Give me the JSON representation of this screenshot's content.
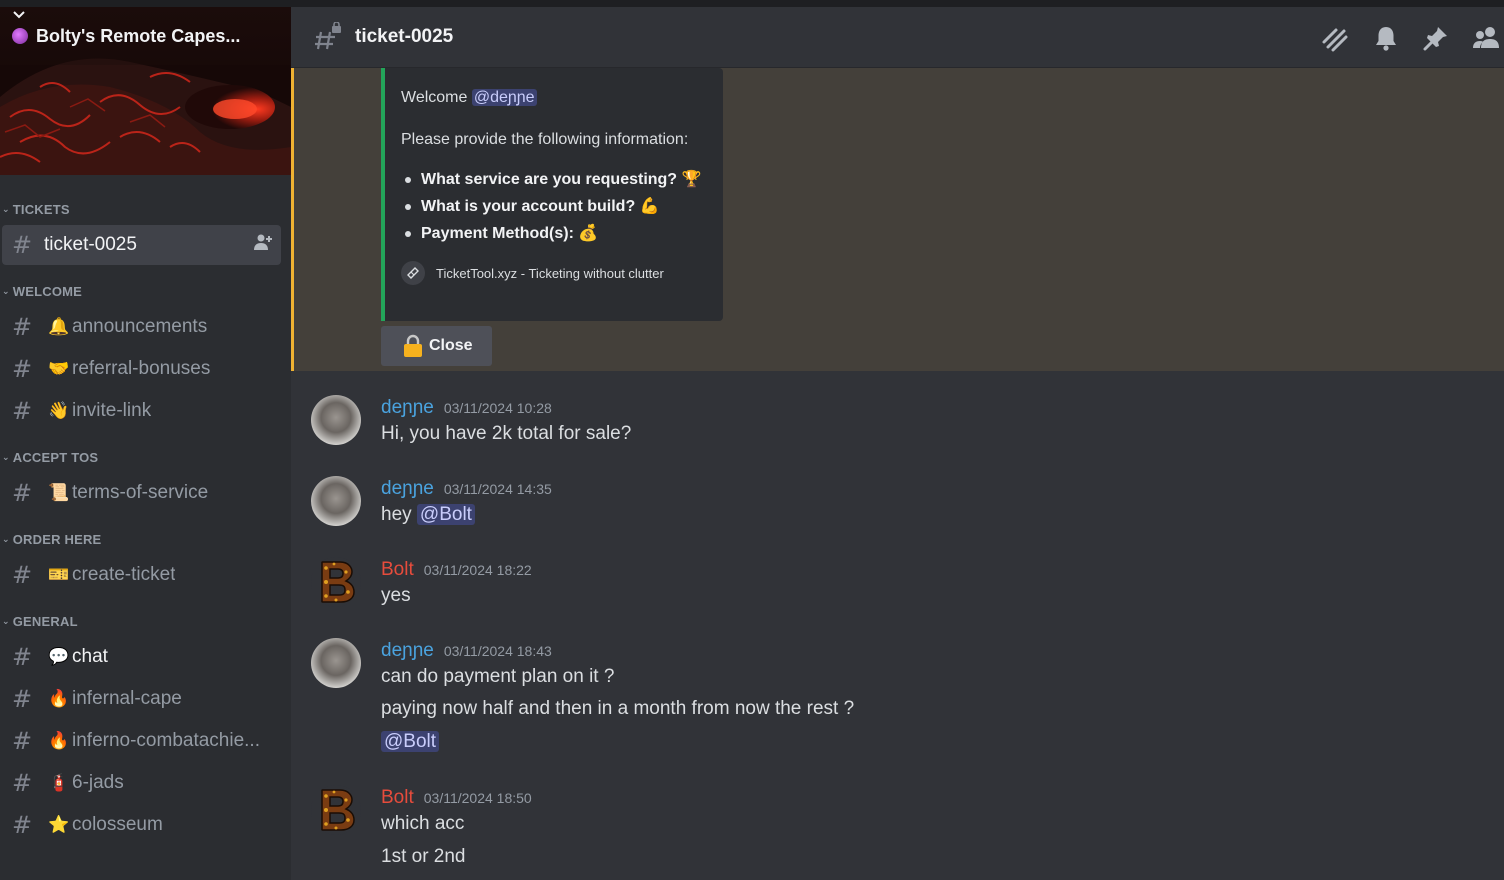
{
  "server": {
    "name": "Bolty's Remote Capes...",
    "icon": "server-icon"
  },
  "channel": {
    "title": "ticket-0025"
  },
  "toolbar_icons": [
    "threads-icon",
    "bell-icon",
    "pin-icon",
    "members-icon"
  ],
  "categories": [
    {
      "label": "TICKETS",
      "channels": [
        {
          "name": "ticket-0025",
          "emoji": "",
          "active": true
        }
      ]
    },
    {
      "label": "WELCOME",
      "channels": [
        {
          "name": "announcements",
          "emoji": "🔔"
        },
        {
          "name": "referral-bonuses",
          "emoji": "🤝"
        },
        {
          "name": "invite-link",
          "emoji": "👋"
        }
      ]
    },
    {
      "label": "ACCEPT TOS",
      "channels": [
        {
          "name": "terms-of-service",
          "emoji": "📜"
        }
      ]
    },
    {
      "label": "ORDER HERE",
      "channels": [
        {
          "name": "create-ticket",
          "emoji": "🎫"
        }
      ]
    },
    {
      "label": "GENERAL",
      "channels": [
        {
          "name": "chat",
          "emoji": "💬",
          "bright": true
        },
        {
          "name": "infernal-cape",
          "emoji": "🔥"
        },
        {
          "name": "inferno-combatachie...",
          "emoji": "🔥"
        },
        {
          "name": "6-jads",
          "emoji": "🧯"
        },
        {
          "name": "colosseum",
          "emoji": "⭐"
        }
      ]
    }
  ],
  "embed": {
    "welcome": "Welcome",
    "welcome_mention": "@deɲɲe",
    "prompt": "Please provide the following information:",
    "items": [
      {
        "text": "What service are you requesting?",
        "emoji": "🏆"
      },
      {
        "text": "What is your account build?",
        "emoji": "💪"
      },
      {
        "text": "Payment Method(s):",
        "emoji": "💰"
      }
    ],
    "footer": "TicketTool.xyz - Ticketing without clutter",
    "close_label": "Close"
  },
  "messages": [
    {
      "author": "deɲɲe",
      "time": "03/11/2024 10:28",
      "lines": [
        "Hi, you have 2k total for sale?"
      ]
    },
    {
      "author": "deɲɲe",
      "time": "03/11/2024 14:35",
      "lines": [
        "hey"
      ],
      "mention": "@Bolt"
    },
    {
      "author": "Bolt",
      "time": "03/11/2024 18:22",
      "lines": [
        "yes"
      ]
    },
    {
      "author": "deɲɲe",
      "time": "03/11/2024 18:43",
      "lines": [
        "can do payment plan on it ?",
        "paying now half and then in a month from now the rest ?"
      ],
      "mention": "@Bolt"
    },
    {
      "author": "Bolt",
      "time": "03/11/2024 18:50",
      "lines": [
        "which acc",
        "1st or 2nd"
      ]
    }
  ],
  "colors": {
    "accent_green": "#23a55a",
    "highlight_bar": "#f0b232",
    "user_denne": "#4aa3df",
    "user_bolt": "#e74c3c"
  }
}
